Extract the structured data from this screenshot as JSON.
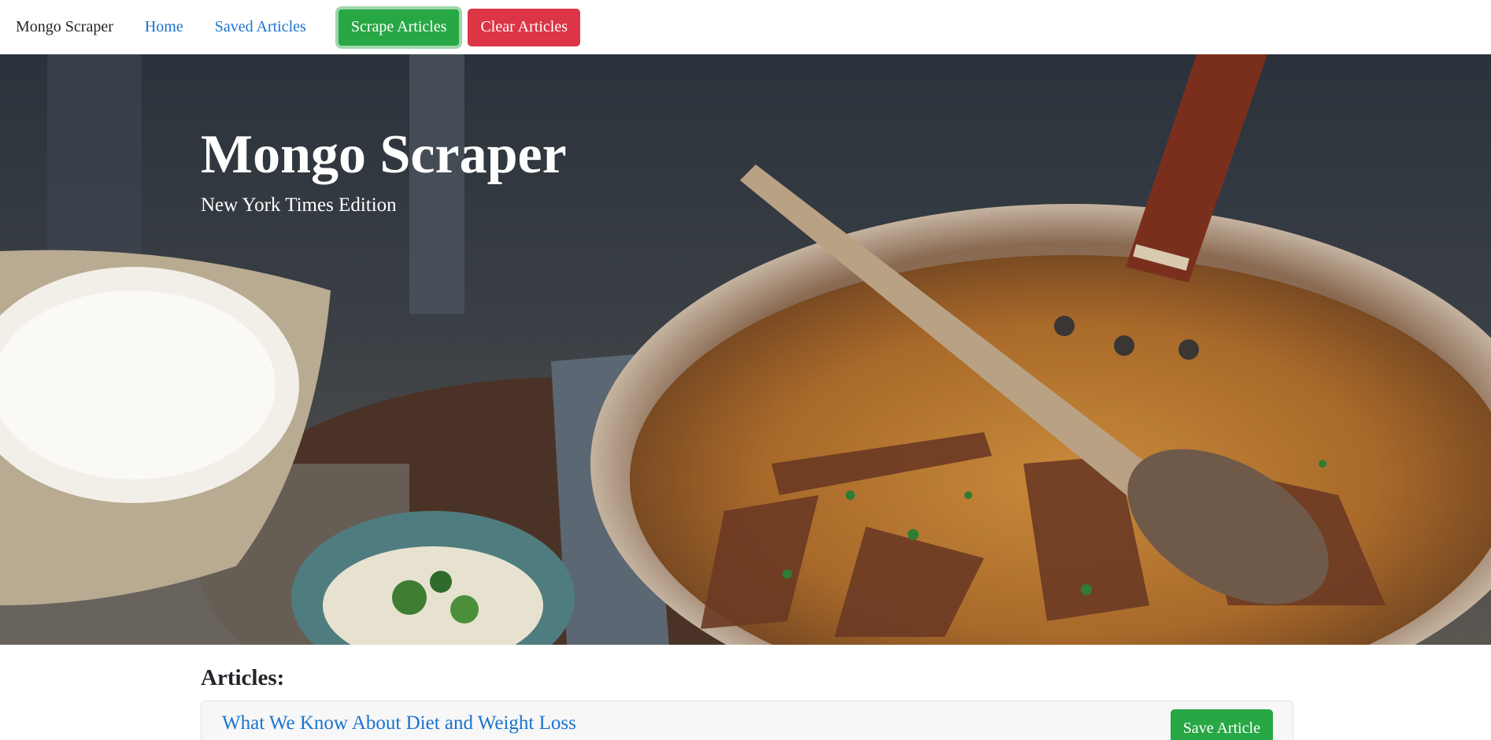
{
  "nav": {
    "brand": "Mongo Scraper",
    "links": [
      "Home",
      "Saved Articles"
    ],
    "scrape_label": "Scrape Articles",
    "clear_label": "Clear Articles"
  },
  "hero": {
    "title": "Mongo Scraper",
    "subtitle": "New York Times Edition"
  },
  "articles": {
    "heading": "Articles:",
    "items": [
      {
        "title": "What We Know About Diet and Weight Loss",
        "save_label": "Save Article"
      }
    ]
  },
  "colors": {
    "link": "#1a73d0",
    "success": "#28a745",
    "danger": "#dc3545"
  }
}
